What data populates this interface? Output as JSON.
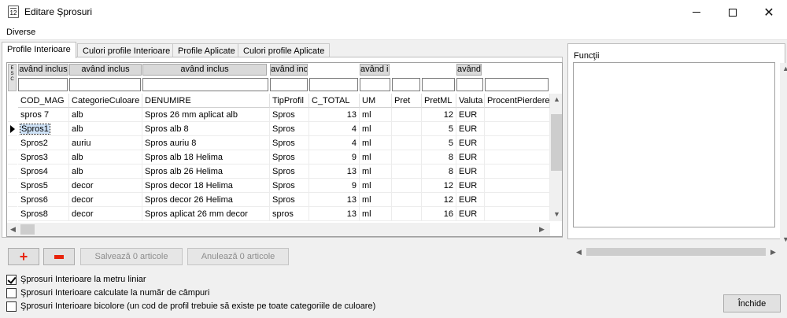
{
  "window": {
    "title": "Editare Șprosuri",
    "icon_text": "12"
  },
  "menu": {
    "items": [
      "Diverse"
    ]
  },
  "tabs": [
    "Profile Interioare",
    "Culori profile Interioare",
    "Profile Aplicate",
    "Culori profile Aplicate"
  ],
  "grid": {
    "esc_label": "E S C",
    "filter_label": "având inclus",
    "columns": [
      "COD_MAG",
      "CategorieCuloare",
      "DENUMIRE",
      "TipProfil",
      "C_TOTAL",
      "UM",
      "Pret",
      "PretML",
      "Valuta",
      "ProcentPierdere"
    ],
    "rows": [
      [
        "spros 7",
        "alb",
        "Spros 26 mm aplicat alb",
        "Spros",
        "13",
        "ml",
        "",
        "12",
        "EUR",
        ""
      ],
      [
        "Spros1",
        "alb",
        "Spros alb 8",
        "Spros",
        "4",
        "ml",
        "",
        "5",
        "EUR",
        ""
      ],
      [
        "Spros2",
        "auriu",
        "Spros auriu 8",
        "Spros",
        "4",
        "ml",
        "",
        "5",
        "EUR",
        ""
      ],
      [
        "Spros3",
        "alb",
        "Spros alb 18 Helima",
        "Spros",
        "9",
        "ml",
        "",
        "8",
        "EUR",
        ""
      ],
      [
        "Spros4",
        "alb",
        "Spros alb 26 Helima",
        "Spros",
        "13",
        "ml",
        "",
        "8",
        "EUR",
        ""
      ],
      [
        "Spros5",
        "decor",
        "Spros decor 18 Helima",
        "Spros",
        "9",
        "ml",
        "",
        "12",
        "EUR",
        ""
      ],
      [
        "Spros6",
        "decor",
        "Spros decor 26 Helima",
        "Spros",
        "13",
        "ml",
        "",
        "12",
        "EUR",
        ""
      ],
      [
        "Spros8",
        "decor",
        "Spros aplicat 26 mm decor",
        "spros",
        "13",
        "ml",
        "",
        "16",
        "EUR",
        ""
      ]
    ],
    "selected_row": 1
  },
  "functions_panel": {
    "label": "Funcţii"
  },
  "buttons": {
    "add_icon": "plus-icon",
    "remove_icon": "minus-icon",
    "save": "Salvează 0 articole",
    "cancel": "Anulează 0 articole",
    "close": "Închide"
  },
  "options": [
    {
      "label": "Şprosuri Interioare la metru liniar",
      "checked": true
    },
    {
      "label": "Şprosuri Interioare calculate la număr de câmpuri",
      "checked": false
    },
    {
      "label": "Şprosuri Interioare bicolore (un cod de profil trebuie să existe pe toate categoriile de culoare)",
      "checked": false
    }
  ],
  "colors": {
    "accent_red": "#e8240c",
    "selection": "#cfe3f8"
  }
}
